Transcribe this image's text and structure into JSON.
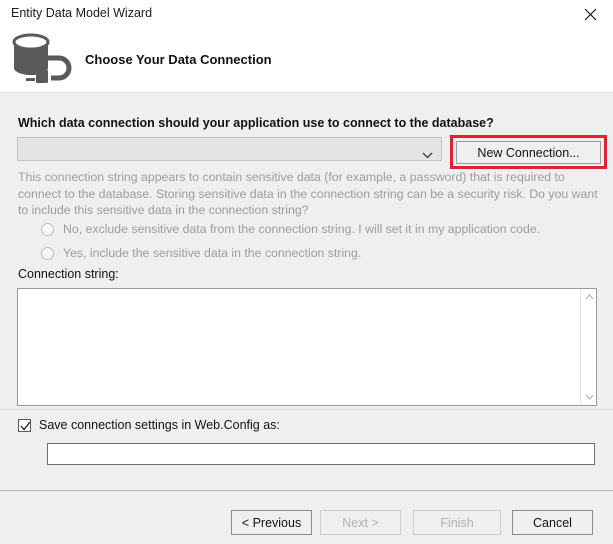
{
  "window": {
    "title": "Entity Data Model Wizard",
    "close_icon": "close-icon"
  },
  "header": {
    "icon": "database-connection-icon",
    "title": "Choose Your Data Connection"
  },
  "main": {
    "question": "Which data connection should your application use to connect to the database?",
    "connection_combo": {
      "value": "",
      "placeholder": "",
      "arrow_icon": "chevron-down-icon"
    },
    "new_connection_button": "New Connection...",
    "sensitive_note": "This connection string appears to contain sensitive data (for example, a password) that is required to connect to the database. Storing sensitive data in the connection string can be a security risk. Do you want to include this sensitive data in the connection string?",
    "radios": [
      {
        "label": "No, exclude sensitive data from the connection string. I will set it in my application code.",
        "selected": false,
        "disabled": true
      },
      {
        "label": "Yes, include the sensitive data in the connection string.",
        "selected": false,
        "disabled": true
      }
    ],
    "connection_string_label": "Connection string:",
    "connection_string_value": "",
    "scrollbar": {
      "up_icon": "chevron-up-icon",
      "down_icon": "chevron-down-icon"
    },
    "save_checkbox": {
      "label": "Save connection settings in Web.Config as:",
      "checked": true,
      "check_icon": "checkmark-icon"
    },
    "webconfig_name_value": "",
    "webconfig_name_placeholder": ""
  },
  "annotation": {
    "highlight_color": "#e0222f",
    "target": "new-connection-button"
  },
  "footer": {
    "buttons": [
      {
        "label": "< Previous",
        "enabled": true
      },
      {
        "label": "Next >",
        "enabled": false
      },
      {
        "label": "Finish",
        "enabled": false
      },
      {
        "label": "Cancel",
        "enabled": true
      }
    ]
  }
}
